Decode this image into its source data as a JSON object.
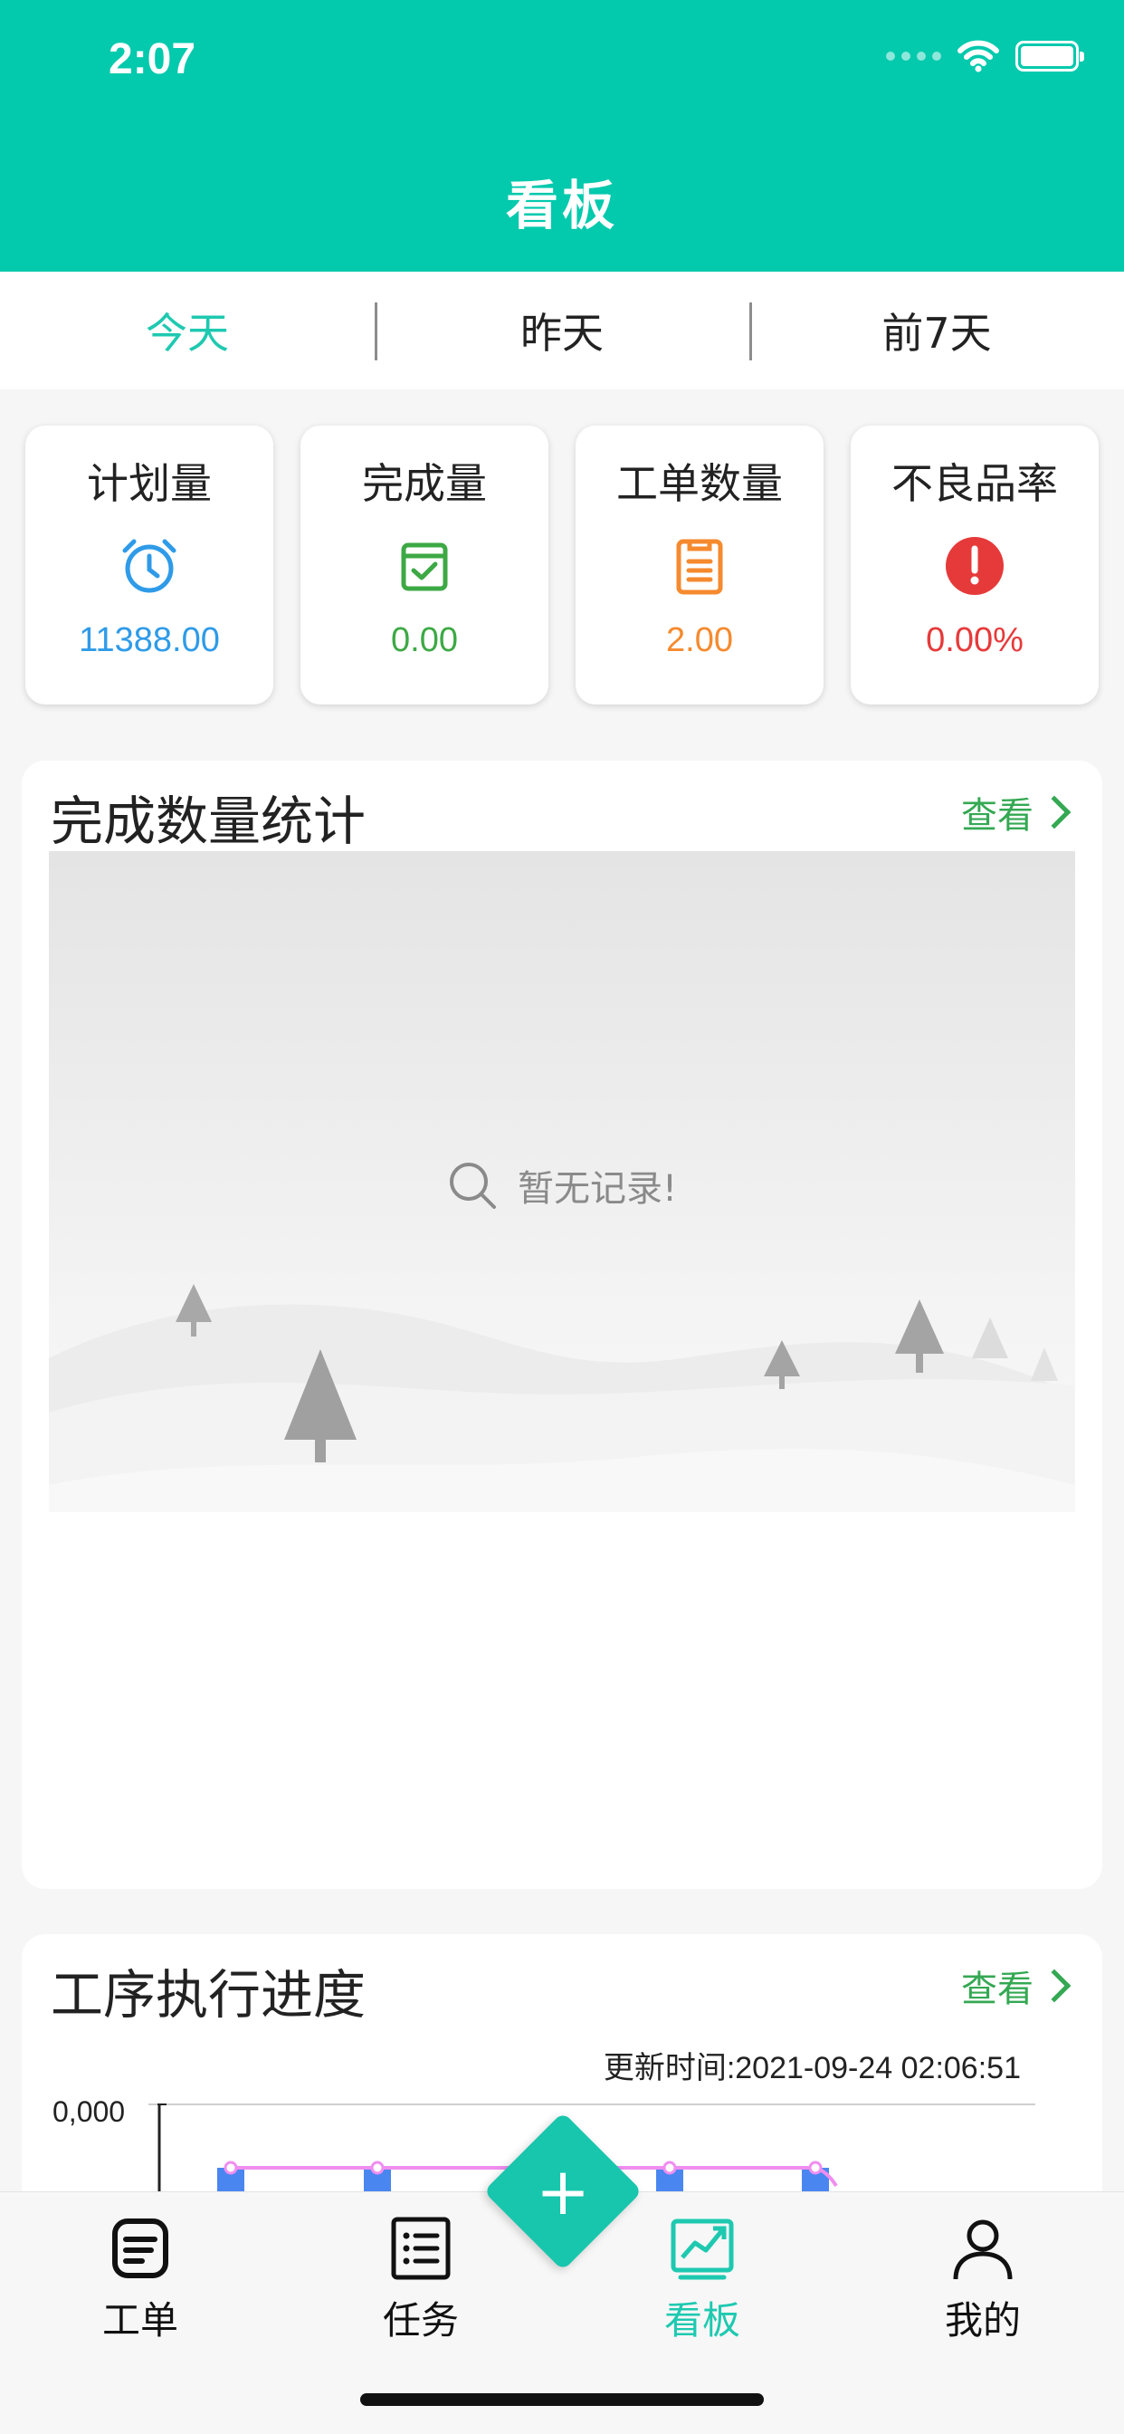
{
  "status_bar": {
    "time": "2:07"
  },
  "header": {
    "title": "看板"
  },
  "tabs": [
    {
      "label": "今天",
      "active": true
    },
    {
      "label": "昨天",
      "active": false
    },
    {
      "label": "前7天",
      "active": false
    }
  ],
  "stats": [
    {
      "label": "计划量",
      "value": "11388.00",
      "icon": "alarm-clock-icon",
      "color": "#2f9be8"
    },
    {
      "label": "完成量",
      "value": "0.00",
      "icon": "check-calendar-icon",
      "color": "#3da945"
    },
    {
      "label": "工单数量",
      "value": "2.00",
      "icon": "clipboard-icon",
      "color": "#f58a2e"
    },
    {
      "label": "不良品率",
      "value": "0.00%",
      "icon": "exclamation-icon",
      "color": "#e63a3a"
    }
  ],
  "completion_panel": {
    "title": "完成数量统计",
    "view_label": "查看",
    "empty_text": "暂无记录!"
  },
  "process_panel": {
    "title": "工序执行进度",
    "view_label": "查看",
    "update_time": "更新时间:2021-09-24 02:06:51",
    "ytick_label": "0,000"
  },
  "bottom_nav": [
    {
      "label": "工单",
      "icon": "work-order-icon",
      "active": false
    },
    {
      "label": "任务",
      "icon": "task-list-icon",
      "active": false
    },
    {
      "label": "看板",
      "icon": "chart-board-icon",
      "active": true
    },
    {
      "label": "我的",
      "icon": "person-icon",
      "active": false
    }
  ],
  "fab": {
    "icon": "plus-icon"
  },
  "colors": {
    "brand": "#03c9ad",
    "active_tab": "#1ec9b0",
    "link": "#34a853"
  }
}
